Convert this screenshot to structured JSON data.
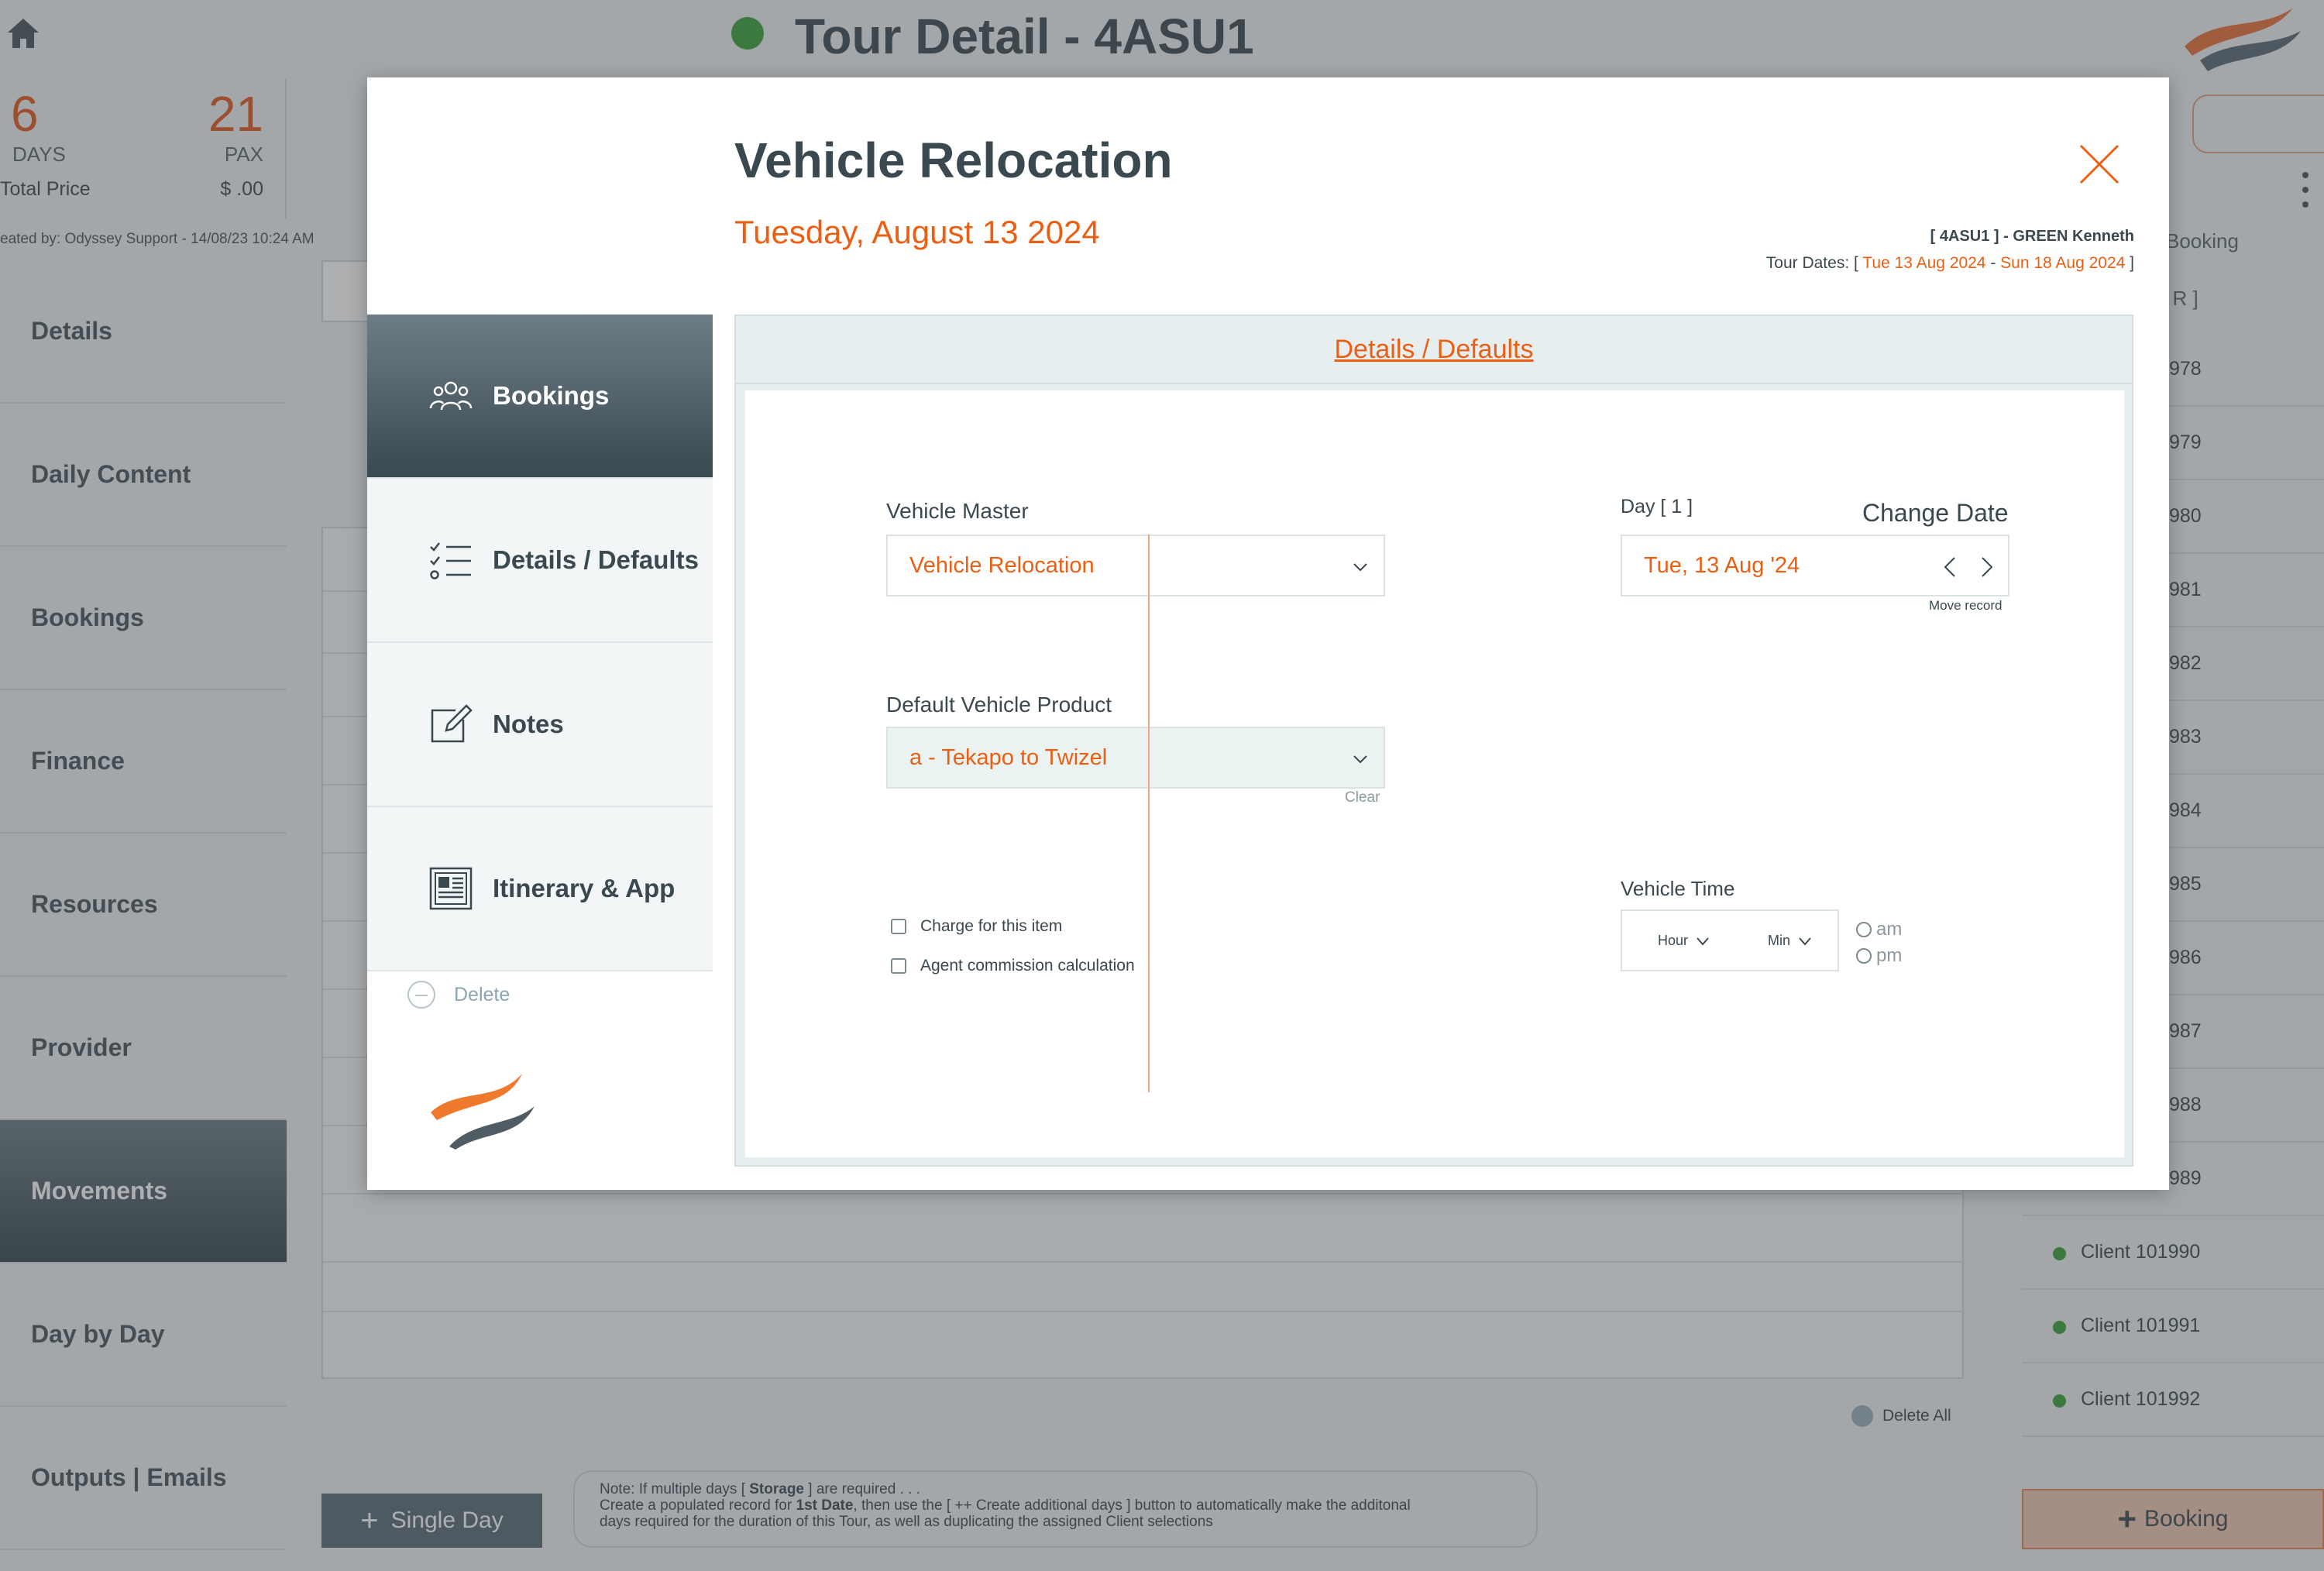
{
  "app": {
    "title": "Tour Detail - 4ASU1",
    "stats": {
      "days": "6",
      "days_label": "DAYS",
      "pax": "21",
      "pax_label": "PAX",
      "total_price_label": "Total Price",
      "total_price": "$ .00"
    },
    "created_by": "eated by: Odyssey Support - 14/08/23 10:24 AM",
    "sidenav": [
      {
        "label": "Details"
      },
      {
        "label": "Daily Content"
      },
      {
        "label": "Bookings"
      },
      {
        "label": "Finance"
      },
      {
        "label": "Resources"
      },
      {
        "label": "Provider"
      },
      {
        "label": "Movements"
      },
      {
        "label": "Day by Day"
      },
      {
        "label": "Outputs | Emails"
      }
    ],
    "right_header": "Booking",
    "right_r": "[ R ]",
    "client_numbers": [
      "978",
      "979",
      "980",
      "981",
      "982",
      "983",
      "984",
      "985",
      "986",
      "987",
      "988",
      "989"
    ],
    "clients": [
      "Client 101990",
      "Client 101991",
      "Client 101992"
    ],
    "delete_all": "Delete All",
    "single_day_button": "Single Day",
    "note_line1_a": "Note: If multiple days [ ",
    "note_line1_b": "Storage",
    "note_line1_c": " ] are required . . .",
    "note_line2_a": "Create a populated record for ",
    "note_line2_b": "1st Date",
    "note_line2_c": ", then use the [ ++ Create additional days ] button to automatically make the additonal",
    "note_line3": "days required for the duration of this Tour, as well as duplicating the assigned Client selections",
    "add_booking_button": "Booking"
  },
  "modal": {
    "title": "Vehicle Relocation",
    "date": "Tuesday, August 13 2024",
    "tour_ref": "[ 4ASU1 ] - GREEN Kenneth",
    "tour_dates_label": "Tour Dates: [ ",
    "tour_start": "Tue 13 Aug 2024",
    "tour_dash": " - ",
    "tour_end": "Sun 18 Aug 2024",
    "tour_dates_close": " ]",
    "nav": [
      {
        "label": "Bookings",
        "icon": "people-icon"
      },
      {
        "label": "Details / Defaults",
        "icon": "checklist-icon"
      },
      {
        "label": "Notes",
        "icon": "edit-icon"
      },
      {
        "label": "Itinerary & App",
        "icon": "newspaper-icon"
      }
    ],
    "delete_label": "Delete",
    "panel_tab": "Details / Defaults",
    "vehicle_master_label": "Vehicle Master",
    "vehicle_master_value": "Vehicle Relocation",
    "default_product_label": "Default Vehicle Product",
    "default_product_value": "a - Tekapo to Twizel",
    "clear_label": "Clear",
    "charge_label": "Charge for this item",
    "agent_commission_label": "Agent commission calculation",
    "day_label": "Day [ 1 ]",
    "change_date_label": "Change Date",
    "date_value": "Tue, 13 Aug '24",
    "move_record_label": "Move record",
    "vehicle_time_label": "Vehicle Time",
    "hour_label": "Hour",
    "min_label": "Min",
    "am_label": "am",
    "pm_label": "pm"
  },
  "colors": {
    "accent": "#ec5f12",
    "dark": "#3a4850",
    "status_green": "#3da23a"
  }
}
